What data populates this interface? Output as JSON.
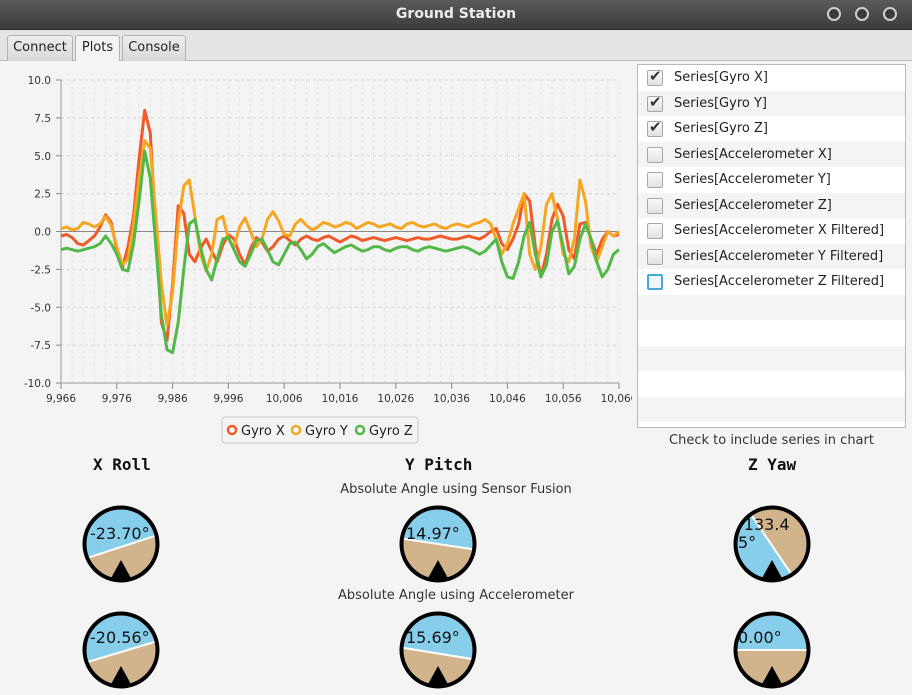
{
  "window": {
    "title": "Ground Station"
  },
  "tabs": [
    {
      "label": "Connect",
      "active": false
    },
    {
      "label": "Plots",
      "active": true
    },
    {
      "label": "Console",
      "active": false
    }
  ],
  "series_list": {
    "items": [
      {
        "label": "Series[Gyro X]",
        "checked": true
      },
      {
        "label": "Series[Gyro Y]",
        "checked": true
      },
      {
        "label": "Series[Gyro Z]",
        "checked": true
      },
      {
        "label": "Series[Accelerometer X]",
        "checked": false
      },
      {
        "label": "Series[Accelerometer Y]",
        "checked": false
      },
      {
        "label": "Series[Accelerometer Z]",
        "checked": false
      },
      {
        "label": "Series[Accelerometer X Filtered]",
        "checked": false
      },
      {
        "label": "Series[Accelerometer Y Filtered]",
        "checked": false
      },
      {
        "label": "Series[Accelerometer Z Filtered]",
        "checked": false
      }
    ],
    "hint": "Check to include series in chart"
  },
  "gauges": {
    "roll_title": "X Roll",
    "pitch_title": "Y Pitch",
    "yaw_title": "Z Yaw",
    "fusion_label": "Absolute Angle using Sensor Fusion",
    "accel_label": "Absolute Angle using Accelerometer",
    "fusion": {
      "roll": "-23.70°",
      "pitch": "14.97°",
      "yaw": "-133.45°"
    },
    "accel": {
      "roll": "-20.56°",
      "pitch": "15.69°",
      "yaw": "0.00°"
    },
    "colors": {
      "sky": "#87ceeb",
      "ground": "#d2b48c",
      "ring": "#000000"
    }
  },
  "chart_data": {
    "type": "line",
    "title": "",
    "xlabel": "",
    "ylabel": "",
    "xlim": [
      9966,
      10066
    ],
    "ylim": [
      -10,
      10
    ],
    "x_ticks": [
      "9,966",
      "9,976",
      "9,986",
      "9,996",
      "10,006",
      "10,016",
      "10,026",
      "10,036",
      "10,046",
      "10,056",
      "10,066"
    ],
    "y_ticks": [
      "10.0",
      "7.5",
      "5.0",
      "2.5",
      "0.0",
      "-2.5",
      "-5.0",
      "-7.5",
      "-10.0"
    ],
    "grid": true,
    "legend": "bottom",
    "x": [
      9966,
      9967,
      9968,
      9969,
      9970,
      9971,
      9972,
      9973,
      9974,
      9975,
      9976,
      9977,
      9978,
      9979,
      9980,
      9981,
      9982,
      9983,
      9984,
      9985,
      9986,
      9987,
      9988,
      9989,
      9990,
      9991,
      9992,
      9993,
      9994,
      9995,
      9996,
      9997,
      9998,
      9999,
      10000,
      10001,
      10002,
      10003,
      10004,
      10005,
      10006,
      10007,
      10008,
      10009,
      10010,
      10011,
      10012,
      10013,
      10014,
      10015,
      10016,
      10017,
      10018,
      10019,
      10020,
      10021,
      10022,
      10023,
      10024,
      10025,
      10026,
      10027,
      10028,
      10029,
      10030,
      10031,
      10032,
      10033,
      10034,
      10035,
      10036,
      10037,
      10038,
      10039,
      10040,
      10041,
      10042,
      10043,
      10044,
      10045,
      10046,
      10047,
      10048,
      10049,
      10050,
      10051,
      10052,
      10053,
      10054,
      10055,
      10056,
      10057,
      10058,
      10059,
      10060,
      10061,
      10062,
      10063,
      10064,
      10065,
      10066
    ],
    "series": [
      {
        "name": "Gyro X",
        "color": "#f05a28",
        "values": [
          -0.3,
          -0.2,
          -0.4,
          -0.8,
          -0.9,
          -0.6,
          -0.3,
          0.3,
          1.1,
          0.6,
          -1.2,
          -2.4,
          -1.0,
          1.0,
          4.8,
          8.0,
          6.5,
          0.0,
          -6.0,
          -7.2,
          -3.5,
          1.7,
          1.2,
          -1.5,
          -2.0,
          -1.1,
          -0.5,
          -1.3,
          -2.0,
          -0.9,
          -0.2,
          -0.5,
          -1.5,
          -2.2,
          -1.1,
          -0.4,
          -0.7,
          -1.3,
          -1.0,
          -0.5,
          -0.3,
          -0.6,
          -0.9,
          -0.5,
          -0.3,
          -0.5,
          -0.6,
          -0.4,
          -0.3,
          -0.5,
          -0.7,
          -0.5,
          -0.3,
          -0.4,
          -0.6,
          -0.5,
          -0.4,
          -0.5,
          -0.6,
          -0.5,
          -0.4,
          -0.5,
          -0.6,
          -0.5,
          -0.4,
          -0.5,
          -0.5,
          -0.4,
          -0.3,
          -0.4,
          -0.5,
          -0.5,
          -0.4,
          -0.3,
          -0.4,
          -0.5,
          -0.3,
          0.0,
          0.2,
          -0.8,
          -1.2,
          -0.5,
          0.5,
          2.5,
          2.0,
          -1.0,
          -3.0,
          -1.5,
          0.8,
          1.8,
          1.0,
          -1.2,
          -1.8,
          0.5,
          0.6,
          -0.5,
          -1.5,
          -0.5,
          0.0,
          -0.3,
          -0.2
        ]
      },
      {
        "name": "Gyro Y",
        "color": "#f5a623",
        "values": [
          0.2,
          0.3,
          0.1,
          0.2,
          0.6,
          0.5,
          0.3,
          0.5,
          1.0,
          0.4,
          -1.0,
          -2.2,
          -1.8,
          0.5,
          3.5,
          6.0,
          5.5,
          1.0,
          -3.5,
          -6.2,
          -4.0,
          0.5,
          3.0,
          3.4,
          1.0,
          -1.5,
          -2.6,
          -1.5,
          0.8,
          1.0,
          -0.5,
          -1.0,
          0.3,
          0.9,
          0.0,
          -1.0,
          -0.5,
          0.8,
          1.3,
          0.7,
          -0.2,
          -0.3,
          0.5,
          0.8,
          0.4,
          0.1,
          0.3,
          0.6,
          0.5,
          0.3,
          0.4,
          0.6,
          0.5,
          0.2,
          0.4,
          0.6,
          0.5,
          0.3,
          0.4,
          0.5,
          0.3,
          0.2,
          0.5,
          0.6,
          0.4,
          0.3,
          0.4,
          0.5,
          0.3,
          0.2,
          0.4,
          0.5,
          0.4,
          0.3,
          0.5,
          0.6,
          0.8,
          0.5,
          -0.5,
          -1.5,
          -0.8,
          0.5,
          1.5,
          2.5,
          -1.5,
          -2.5,
          -1.0,
          1.8,
          2.5,
          0.8,
          -1.5,
          -2.0,
          -0.5,
          3.4,
          2.0,
          -1.0,
          -2.0,
          -1.0,
          0.0,
          -0.3,
          0.0
        ]
      },
      {
        "name": "Gyro Z",
        "color": "#52b848",
        "values": [
          -1.2,
          -1.1,
          -1.2,
          -1.3,
          -1.2,
          -1.1,
          -1.0,
          -0.8,
          -0.3,
          -0.8,
          -1.5,
          -2.5,
          -2.6,
          -0.8,
          2.0,
          5.3,
          3.5,
          -1.0,
          -5.5,
          -7.8,
          -8.0,
          -6.0,
          -2.5,
          0.5,
          0.8,
          -1.0,
          -2.5,
          -3.2,
          -1.8,
          -0.5,
          -0.4,
          -1.2,
          -2.0,
          -2.3,
          -1.5,
          -0.6,
          -0.5,
          -1.2,
          -2.0,
          -2.2,
          -1.5,
          -0.8,
          -0.7,
          -1.2,
          -1.8,
          -1.5,
          -1.0,
          -0.8,
          -1.1,
          -1.4,
          -1.2,
          -1.0,
          -0.9,
          -1.1,
          -1.3,
          -1.2,
          -1.0,
          -1.0,
          -1.2,
          -1.3,
          -1.1,
          -1.0,
          -1.0,
          -1.2,
          -1.3,
          -1.1,
          -1.0,
          -1.1,
          -1.2,
          -1.3,
          -1.2,
          -1.1,
          -1.0,
          -1.1,
          -1.3,
          -1.5,
          -1.3,
          -0.9,
          -0.5,
          -2.0,
          -3.0,
          -3.1,
          -2.0,
          -0.3,
          0.6,
          -1.5,
          -3.0,
          -2.2,
          0.0,
          0.7,
          -1.0,
          -2.8,
          -2.3,
          -0.5,
          0.5,
          -0.5,
          -2.0,
          -3.0,
          -2.5,
          -1.5,
          -1.2
        ]
      }
    ]
  }
}
